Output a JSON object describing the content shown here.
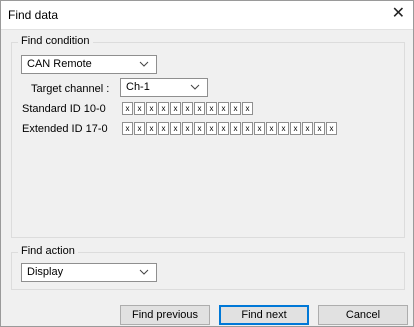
{
  "dialog": {
    "title": "Find data",
    "close_glyph": "✕"
  },
  "find_condition": {
    "group_label": "Find condition",
    "type_selected": "CAN Remote",
    "target_channel_label": "Target channel :",
    "target_channel_selected": "Ch-1",
    "standard_id_label": "Standard ID 10-0",
    "standard_id_bits": [
      "x",
      "x",
      "x",
      "x",
      "x",
      "x",
      "x",
      "x",
      "x",
      "x",
      "x"
    ],
    "extended_id_label": "Extended ID 17-0",
    "extended_id_bits": [
      "x",
      "x",
      "x",
      "x",
      "x",
      "x",
      "x",
      "x",
      "x",
      "x",
      "x",
      "x",
      "x",
      "x",
      "x",
      "x",
      "x",
      "x"
    ]
  },
  "find_action": {
    "group_label": "Find action",
    "selected": "Display"
  },
  "buttons": {
    "find_previous": "Find previous",
    "find_next": "Find next",
    "cancel": "Cancel"
  },
  "icons": {
    "dropdown": "chevron-down-icon",
    "close": "close-icon"
  },
  "colors": {
    "accent": "#0078d7"
  }
}
